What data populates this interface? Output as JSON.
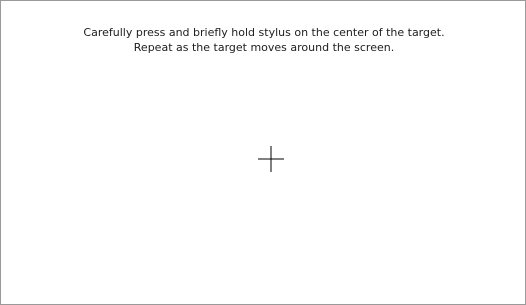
{
  "instructions": {
    "line1": "Carefully press and briefly hold stylus on the center of the target.",
    "line2": "Repeat as the target moves around the screen."
  },
  "target": {
    "icon": "crosshair-icon",
    "color": "#000000"
  },
  "colors": {
    "background": "#ffffff",
    "text": "#202020",
    "border": "#9a9a9a"
  }
}
